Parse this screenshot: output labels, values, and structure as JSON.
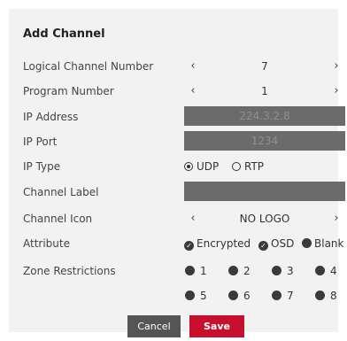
{
  "dialog": {
    "title": "Add Channel"
  },
  "fields": {
    "logical_channel_number": {
      "label": "Logical Channel Number",
      "value": "7"
    },
    "program_number": {
      "label": "Program Number",
      "value": "1"
    },
    "ip_address": {
      "label": "IP Address",
      "value": "224.3.2.8"
    },
    "ip_port": {
      "label": "IP Port",
      "value": "1234"
    },
    "ip_type": {
      "label": "IP Type",
      "options": [
        "UDP",
        "RTP"
      ],
      "selected": "UDP"
    },
    "channel_label": {
      "label": "Channel Label",
      "value": ""
    },
    "channel_icon": {
      "label": "Channel Icon",
      "value": "NO LOGO"
    },
    "attribute": {
      "label": "Attribute",
      "options": [
        "Encrypted",
        "OSD",
        "Blank"
      ]
    },
    "zone_restrictions": {
      "label": "Zone Restrictions",
      "zones": [
        "1",
        "2",
        "3",
        "4",
        "5",
        "6",
        "7",
        "8"
      ]
    }
  },
  "icons": {
    "prev": "chevron-left-icon",
    "next": "chevron-right-icon",
    "check": "check-circle-icon"
  },
  "buttons": {
    "cancel": "Cancel",
    "save": "Save"
  },
  "colors": {
    "accent": "#c8102e",
    "input_bg": "#6b6b6b",
    "panel_bg": "#f2f2f2"
  }
}
